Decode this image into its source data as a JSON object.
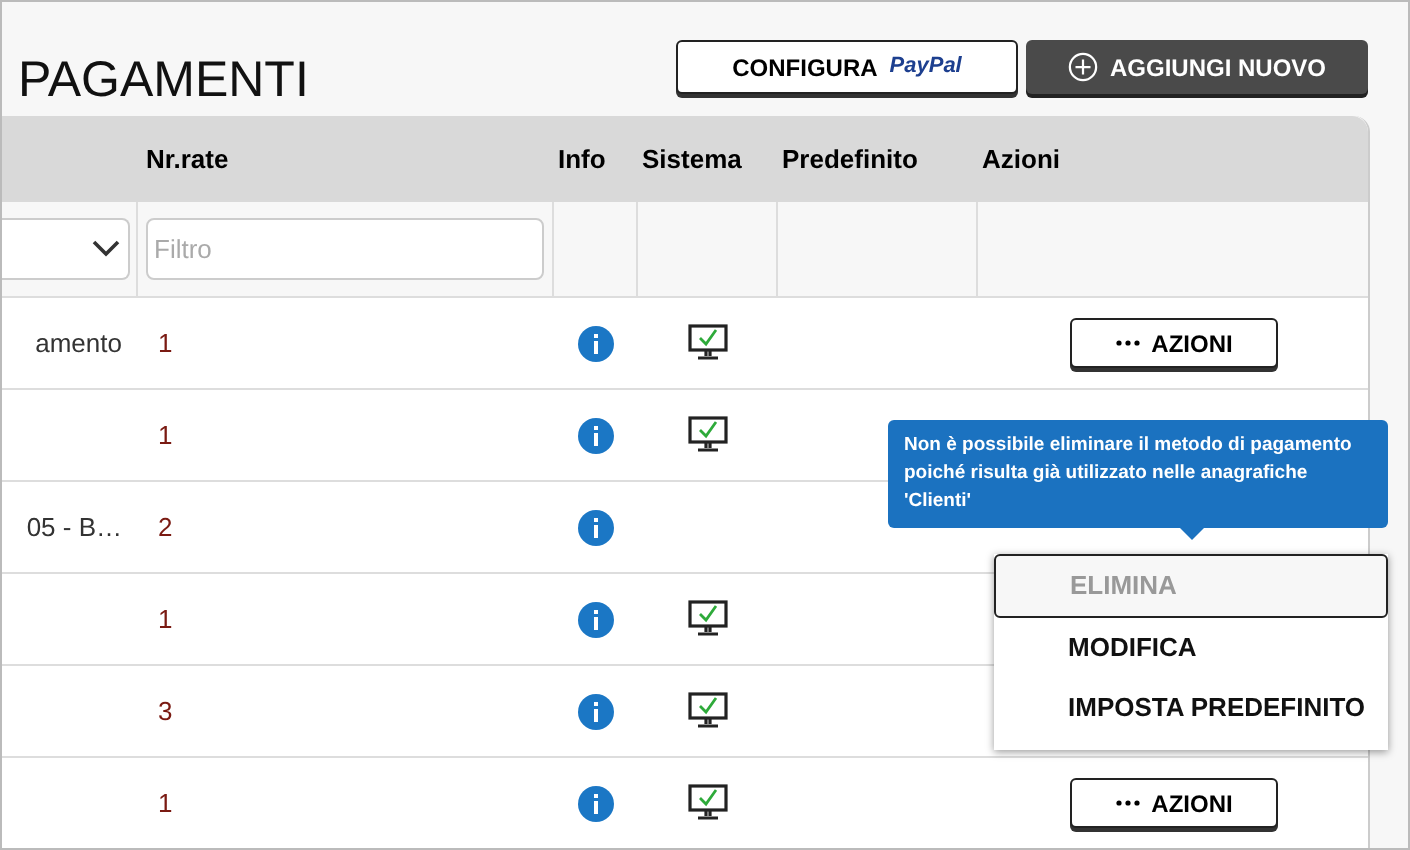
{
  "title": "PAGAMENTI",
  "header_buttons": [
    {
      "kind": "paypal",
      "label": "CONFIGURA",
      "brand": "PayPal"
    },
    {
      "kind": "add",
      "label": "AGGIUNGI NUOVO"
    }
  ],
  "table": {
    "columns": [
      "Nr.rate",
      "Info",
      "Sistema",
      "Predefinito",
      "Azioni"
    ],
    "filter": {
      "placeholder": "Filtro"
    },
    "rows": [
      {
        "column_1": "amento",
        "rate": "1",
        "system": true,
        "action": "AZIONI"
      },
      {
        "column_1": "",
        "rate": "1",
        "system": true
      },
      {
        "column_1": "05 - B…",
        "rate": "2",
        "system": false
      },
      {
        "column_1": "",
        "rate": "1",
        "system": true
      },
      {
        "column_1": "",
        "rate": "3",
        "system": true
      },
      {
        "column_1": "",
        "rate": "1",
        "system": true,
        "action": "AZIONI"
      }
    ]
  },
  "tooltip": "Non è possibile eliminare il metodo di pagamento poiché risulta già utilizzato nelle anagrafiche 'Clienti'",
  "menu": [
    {
      "label": "ELIMINA",
      "disabled": true
    },
    {
      "label": "MODIFICA",
      "disabled": false
    },
    {
      "label": "IMPOSTA PREDEFINITO",
      "disabled": false
    }
  ]
}
